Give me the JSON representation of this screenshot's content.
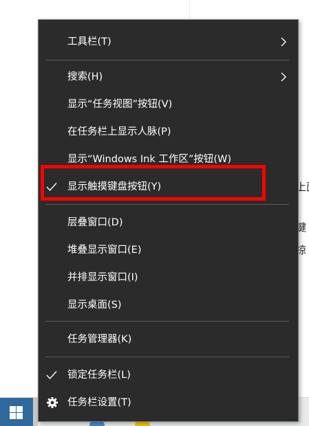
{
  "background": {
    "fragments": [
      "上面",
      "鍵",
      "掠"
    ]
  },
  "context_menu": {
    "items": [
      {
        "label": "工具栏(T)",
        "submenu": true
      },
      {
        "label": "搜索(H)",
        "submenu": true
      },
      {
        "label": "显示“任务视图”按钮(V)"
      },
      {
        "label": "在任务栏上显示人脉(P)"
      },
      {
        "label": "显示“Windows Ink 工作区”按钮(W)"
      },
      {
        "label": "显示触摸键盘按钮(Y)",
        "checked": true
      },
      {
        "label": "层叠窗口(D)"
      },
      {
        "label": "堆叠显示窗口(E)"
      },
      {
        "label": "并排显示窗口(I)"
      },
      {
        "label": "显示桌面(S)"
      },
      {
        "label": "任务管理器(K)"
      },
      {
        "label": "锁定任务栏(L)",
        "checked": true
      },
      {
        "label": "任务栏设置(T)",
        "icon": "gear-icon"
      }
    ]
  },
  "colors": {
    "menu_background": "#2b2b2b",
    "menu_text": "#ffffff",
    "highlight": "#ff0000",
    "start_button": "#2f6a9c"
  }
}
